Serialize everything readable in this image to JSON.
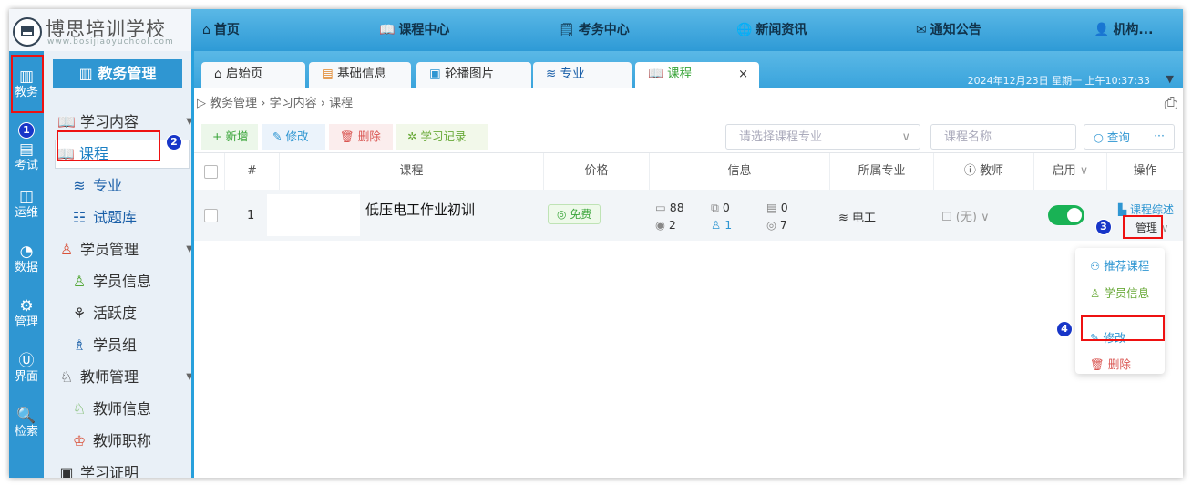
{
  "logo": {
    "title": "博思培训学校",
    "subtitle": "www.bosijiaoyuchool.com"
  },
  "topnav": [
    {
      "icon": "⌂",
      "label": "首页"
    },
    {
      "icon": "📖",
      "label": "课程中心"
    },
    {
      "icon": "🗒",
      "label": "考务中心"
    },
    {
      "icon": "🌐",
      "label": "新闻资讯"
    },
    {
      "icon": "✉",
      "label": "通知公告"
    },
    {
      "icon": "👤",
      "label": "机构..."
    }
  ],
  "rail": [
    {
      "icon": "▥",
      "label": "教务"
    },
    {
      "icon": "▤",
      "label": "考试"
    },
    {
      "icon": "◫",
      "label": "运维"
    },
    {
      "icon": "◔",
      "label": "数据"
    },
    {
      "icon": "⚙",
      "label": "管理"
    },
    {
      "icon": "Ⓤ",
      "label": "界面"
    },
    {
      "icon": "🔍",
      "label": "检索"
    }
  ],
  "sidebar": {
    "header": "教务管理",
    "items": [
      {
        "icon": "📖",
        "label": "学习内容",
        "type": "group"
      },
      {
        "icon": "📖",
        "label": "课程",
        "type": "selected"
      },
      {
        "icon": "≋",
        "label": "专业",
        "type": "sub"
      },
      {
        "icon": "☷",
        "label": "试题库",
        "type": "sub"
      },
      {
        "icon": "♙",
        "label": "学员管理",
        "type": "group"
      },
      {
        "icon": "♙",
        "label": "学员信息",
        "type": "sub"
      },
      {
        "icon": "⚘",
        "label": "活跃度",
        "type": "sub"
      },
      {
        "icon": "♗",
        "label": "学员组",
        "type": "sub"
      },
      {
        "icon": "♘",
        "label": "教师管理",
        "type": "group"
      },
      {
        "icon": "♘",
        "label": "教师信息",
        "type": "sub"
      },
      {
        "icon": "♔",
        "label": "教师职称",
        "type": "sub"
      },
      {
        "icon": "▣",
        "label": "学习证明",
        "type": "group"
      }
    ]
  },
  "tabs": [
    {
      "icon": "⌂",
      "label": "启始页"
    },
    {
      "icon": "▤",
      "label": "基础信息"
    },
    {
      "icon": "▣",
      "label": "轮播图片"
    },
    {
      "icon": "≋",
      "label": "专业"
    },
    {
      "icon": "📖",
      "label": "课程",
      "close": "×"
    }
  ],
  "datetime": "2024年12月23日 星期一 上午10:37:33",
  "breadcrumb": [
    "教务管理",
    "学习内容",
    "课程"
  ],
  "toolbar": {
    "add": "+ 新增",
    "edit": "修改",
    "delete": "删除",
    "records": "学习记录",
    "major_placeholder": "请选择课程专业",
    "name_placeholder": "课程名称",
    "query": "查询",
    "more": "···"
  },
  "table": {
    "headers": [
      "#",
      "课程",
      "价格",
      "信息",
      "所属专业",
      "教师",
      "启用",
      "操作"
    ],
    "rows": [
      {
        "index": "1",
        "course": "低压电工作业初训",
        "price": "免费",
        "info": {
          "a": "88",
          "b": "0",
          "c": "0",
          "d": "2",
          "e": "1",
          "f": "7"
        },
        "major": "电工",
        "teacher": "(无)",
        "enabled": true,
        "summary": "课程综述",
        "manage": "管理"
      }
    ]
  },
  "dropdown": [
    "推荐课程",
    "学员信息",
    "修改",
    "删除"
  ],
  "markers": [
    "1",
    "2",
    "3",
    "4"
  ],
  "colors": {
    "accent": "#2f96d2",
    "green": "#3aa53a",
    "danger": "#e11",
    "marker": "#1836c8"
  }
}
